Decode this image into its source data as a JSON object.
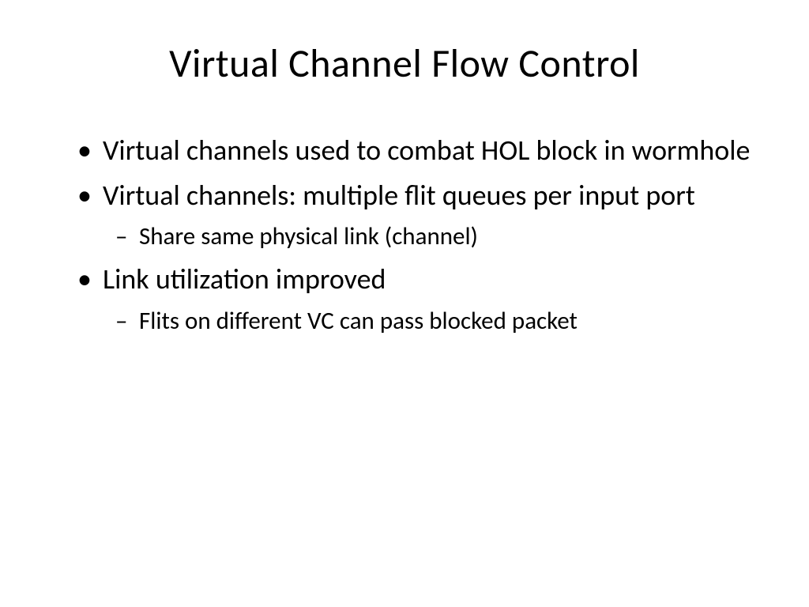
{
  "slide": {
    "title": "Virtual Channel Flow Control",
    "bullets": [
      {
        "text": "Virtual channels used to combat HOL block in wormhole",
        "sub": []
      },
      {
        "text": "Virtual channels: multiple flit queues per input port",
        "sub": [
          "Share same physical link (channel)"
        ]
      },
      {
        "text": "Link utilization improved",
        "sub": [
          "Flits on different VC can pass blocked packet"
        ]
      }
    ]
  }
}
